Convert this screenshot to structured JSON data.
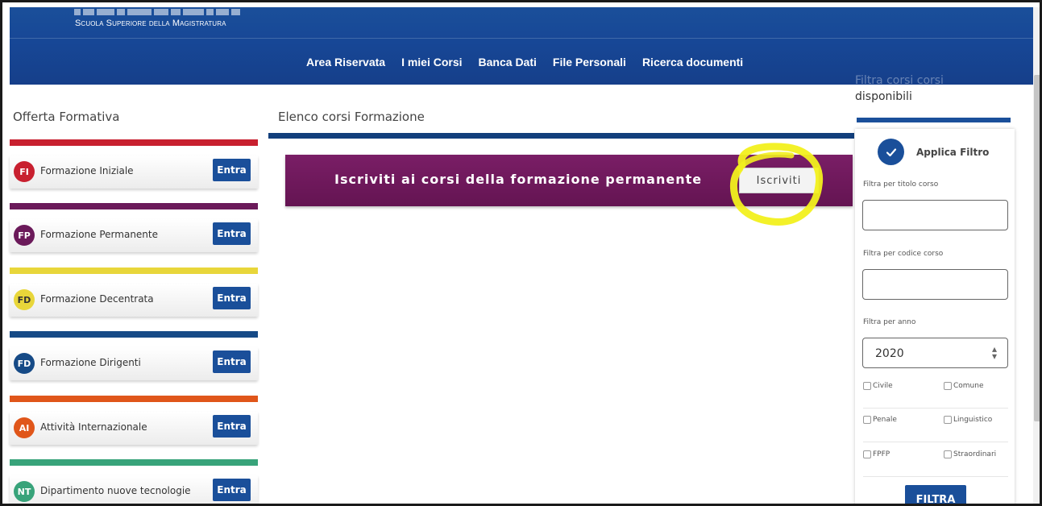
{
  "header": {
    "school_name": "Scuola Superiore della Magistratura",
    "nav": [
      "Area Riservata",
      "I miei Corsi",
      "Banca Dati",
      "File Personali",
      "Ricerca documenti"
    ]
  },
  "sidebar": {
    "title": "Offerta Formativa",
    "items": [
      {
        "badge": "FI",
        "label": "Formazione Iniziale",
        "button": "Entra",
        "color": "#c8202f"
      },
      {
        "badge": "FP",
        "label": "Formazione Permanente",
        "button": "Entra",
        "color": "#6b1a5a"
      },
      {
        "badge": "FD",
        "label": "Formazione Decentrata",
        "button": "Entra",
        "color": "#e8d63a"
      },
      {
        "badge": "FD",
        "label": "Formazione Dirigenti",
        "button": "Entra",
        "color": "#164a86"
      },
      {
        "badge": "AI",
        "label": "Attività Internazionale",
        "button": "Entra",
        "color": "#e0561a"
      },
      {
        "badge": "NT",
        "label": "Dipartimento nuove tecnologie",
        "button": "Entra",
        "color": "#38a37a"
      }
    ]
  },
  "main": {
    "title": "Elenco corsi Formazione",
    "banner_text": "Iscriviti ai corsi della formazione permanente",
    "banner_button": "Iscriviti"
  },
  "filter": {
    "heading_ghost": "Filtra corsi corsi",
    "heading": "disponibili",
    "apply_label": "Applica Filtro",
    "title_label": "Filtra per titolo corso",
    "title_value": "",
    "code_label": "Filtra per codice corso",
    "code_value": "",
    "year_label": "Filtra per anno",
    "year_value": "2020",
    "checkboxes": [
      "Civile",
      "Comune",
      "Penale",
      "Linguistico",
      "FPFP",
      "Straordinari"
    ],
    "submit": "FILTRA"
  },
  "colors": {
    "brand_blue": "#1a4f9a",
    "banner_purple": "#6b1a5a",
    "highlight_yellow": "#f2f01e"
  }
}
